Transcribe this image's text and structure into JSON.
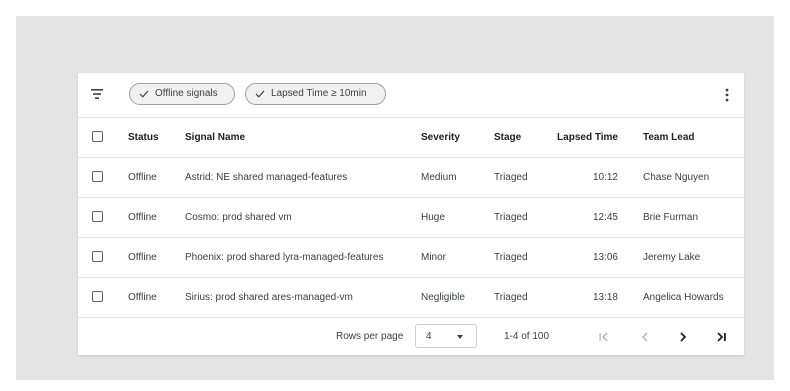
{
  "filters": [
    {
      "label": "Offline signals"
    },
    {
      "label": "Lapsed Time ≥ 10min"
    }
  ],
  "table": {
    "columns": [
      "Status",
      "Signal Name",
      "Severity",
      "Stage",
      "Lapsed Time",
      "Team Lead"
    ],
    "rows": [
      {
        "status": "Offline",
        "signal_name": "Astrid: NE shared managed-features",
        "severity": "Medium",
        "stage": "Triaged",
        "lapsed_time": "10:12",
        "team_lead": "Chase Nguyen"
      },
      {
        "status": "Offline",
        "signal_name": "Cosmo: prod shared vm",
        "severity": "Huge",
        "stage": "Triaged",
        "lapsed_time": "12:45",
        "team_lead": "Brie Furman"
      },
      {
        "status": "Offline",
        "signal_name": "Phoenix: prod shared lyra-managed-features",
        "severity": "Minor",
        "stage": "Triaged",
        "lapsed_time": "13:06",
        "team_lead": "Jeremy Lake"
      },
      {
        "status": "Offline",
        "signal_name": "Sirius: prod shared ares-managed-vm",
        "severity": "Negligible",
        "stage": "Triaged",
        "lapsed_time": "13:18",
        "team_lead": "Angelica Howards"
      }
    ]
  },
  "pagination": {
    "rows_per_page_label": "Rows per page",
    "rows_per_page_value": "4",
    "range_text": "1-4 of 100"
  },
  "icons": {
    "filter": "filter-icon",
    "more": "more-vert-icon",
    "check": "check-icon",
    "first": "first-page-icon",
    "prev": "chevron-left-icon",
    "next": "chevron-right-icon",
    "last": "last-page-icon"
  },
  "colors": {
    "backdrop": "#e4e4e4",
    "chip_bg": "#f1f1f1",
    "disabled_icon": "#b0b0b0",
    "text": "#202124"
  }
}
